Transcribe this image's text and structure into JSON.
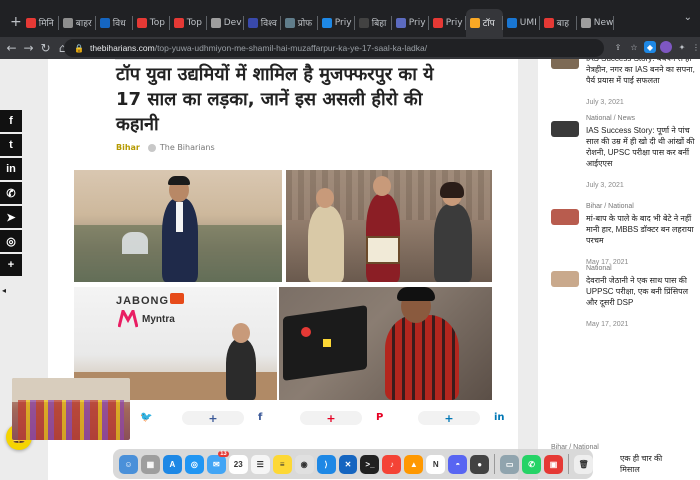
{
  "browser": {
    "tabs": [
      {
        "label": "मिनि",
        "color": "#e53935"
      },
      {
        "label": "बाहर",
        "color": "#8e8e8e"
      },
      {
        "label": "विध",
        "color": "#1565c0"
      },
      {
        "label": "Top",
        "color": "#e53935"
      },
      {
        "label": "Top",
        "color": "#e53935"
      },
      {
        "label": "Dev",
        "color": "#9e9e9e"
      },
      {
        "label": "विश्व",
        "color": "#3949ab"
      },
      {
        "label": "प्रोफ",
        "color": "#607d8b"
      },
      {
        "label": "Priy",
        "color": "#1e88e5"
      },
      {
        "label": "बिहा",
        "color": "#424242"
      },
      {
        "label": "Priy",
        "color": "#5c6bc0"
      },
      {
        "label": "Priy",
        "color": "#e53935"
      },
      {
        "label": "टॉप",
        "color": "#f9a825",
        "active": true
      },
      {
        "label": "UMI",
        "color": "#1976d2"
      },
      {
        "label": "बाह",
        "color": "#e53935"
      },
      {
        "label": "New",
        "color": "#9e9e9e"
      }
    ],
    "new_tab": "+",
    "url_host": "thebiharians.com",
    "url_path": "/top-yuwa-udhmiyon-me-shamil-hai-muzaffarpur-ka-ye-17-saal-ka-ladka/"
  },
  "article": {
    "headline": "टॉप युवा उद्यमियों में शामिल है मुजफ्फरपुर का ये 17 साल का लड़का, जानें इस असली हीरो की कहानी",
    "category": "Bihar",
    "author": "The Biharians",
    "collage": {
      "jabong": "JABONG",
      "myntra": "Myntra"
    },
    "share": [
      {
        "plus": "+",
        "service_icon": "twitter-icon",
        "glyph": "🐦",
        "color": "#1da1f2"
      },
      {
        "plus": "+",
        "service_icon": "facebook-icon",
        "glyph": "f",
        "color": "#3b5998"
      },
      {
        "plus": "+",
        "service_icon": "pinterest-icon",
        "glyph": "P",
        "color": "#e60023"
      },
      {
        "plus": "+",
        "service_icon": "linkedin-icon",
        "glyph": "in",
        "color": "#0077b5"
      }
    ]
  },
  "social": [
    {
      "name": "facebook-icon",
      "glyph": "f"
    },
    {
      "name": "twitter-icon",
      "glyph": "t"
    },
    {
      "name": "linkedin-icon",
      "glyph": "in"
    },
    {
      "name": "whatsapp-icon",
      "glyph": "✆"
    },
    {
      "name": "telegram-icon",
      "glyph": "➤"
    },
    {
      "name": "instagram-icon",
      "glyph": "◎"
    },
    {
      "name": "more-icon",
      "glyph": "+"
    }
  ],
  "sidebar": {
    "items": [
      {
        "category": "",
        "title": "IAS Success Story: बचपन से ही नेत्रहीन, नगर का IAS बनने का सपना, पैर्य प्रयास में पाई सफलता",
        "date": "July 3, 2021",
        "thumb": "#7d6a55"
      },
      {
        "category": "National / News",
        "title": "IAS Success Story: पूर्णा ने पांच साल की उम्र में ही खो दी थी आंखों की रोशनी, UPSC परीक्षा पास कर बनीं आईएएस",
        "date": "July 3, 2021",
        "thumb": "#3a3a3a"
      },
      {
        "category": "Bihar / National",
        "title": "मां-बाप के पाले के बाद भी बेटे ने नहीं मानी हार, MBBS डॉक्टर बन लहराया परचम",
        "date": "May 17, 2021",
        "thumb": "#b85c4e"
      },
      {
        "category": "National",
        "title": "देवरानी जेठानी ने एक साथ पास की UPPSC परीक्षा, एक बनी प्रिंसिपल और दूसरी DSP",
        "date": "May 17, 2021",
        "thumb": "#c9a98c"
      }
    ],
    "bottom_category": "Bihar / National",
    "bottom_title_partial": "एक ही चार की मिसाल"
  },
  "dock": [
    {
      "name": "finder-icon",
      "color": "#4a90d9",
      "glyph": "☺"
    },
    {
      "name": "launchpad-icon",
      "color": "#9e9e9e",
      "glyph": "▦"
    },
    {
      "name": "app-store-icon",
      "color": "#1e88e5",
      "glyph": "A"
    },
    {
      "name": "safari-icon",
      "color": "#2196f3",
      "glyph": "◎"
    },
    {
      "name": "mail-icon",
      "color": "#42a5f5",
      "glyph": "✉",
      "badge": "13"
    },
    {
      "name": "calendar-icon",
      "color": "#ffffff",
      "glyph": "23",
      "dark": true
    },
    {
      "name": "reminders-icon",
      "color": "#f5f5f5",
      "glyph": "☰",
      "dark": true
    },
    {
      "name": "notes-icon",
      "color": "#fdd835",
      "glyph": "≡",
      "dark": true
    },
    {
      "name": "chrome-icon",
      "color": "#e0e0e0",
      "glyph": "◉",
      "dark": true
    },
    {
      "name": "vscode-icon",
      "color": "#1e88e5",
      "glyph": "⟩"
    },
    {
      "name": "xcode-icon",
      "color": "#1565c0",
      "glyph": "✕"
    },
    {
      "name": "terminal-icon",
      "color": "#212121",
      "glyph": ">_"
    },
    {
      "name": "music-icon",
      "color": "#f44336",
      "glyph": "♪"
    },
    {
      "name": "vlc-icon",
      "color": "#ff9800",
      "glyph": "▲"
    },
    {
      "name": "notion-icon",
      "color": "#ffffff",
      "glyph": "N",
      "dark": true
    },
    {
      "name": "discord-icon",
      "color": "#5865f2",
      "glyph": "◓"
    },
    {
      "name": "github-icon",
      "color": "#424242",
      "glyph": "●"
    },
    {
      "name": "preview-icon",
      "color": "#90a4ae",
      "glyph": "▭"
    },
    {
      "name": "whatsapp-icon",
      "color": "#25d366",
      "glyph": "✆"
    },
    {
      "name": "anydesk-icon",
      "color": "#e53935",
      "glyph": "▣"
    },
    {
      "name": "trash-icon",
      "color": "#eeeeee",
      "glyph": "🗑",
      "dark": true
    }
  ]
}
